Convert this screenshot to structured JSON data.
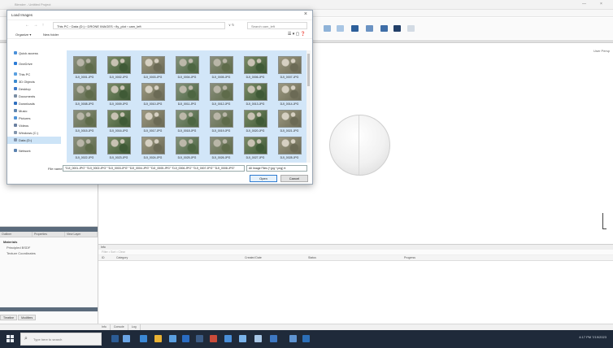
{
  "window": {
    "title": "Blender - Untitled Project",
    "controls": {
      "minimize": "—",
      "close": "×"
    }
  },
  "viewport": {
    "label": "User Persp"
  },
  "left_panel": {
    "tabs": [
      "Outliner",
      "Properties",
      "View Layer"
    ],
    "title": "Materials",
    "items": [
      "Principled BSDF",
      "Texture Coordinates"
    ],
    "bottom_tabs": [
      "Timeline",
      "Modifiers"
    ]
  },
  "results_panel": {
    "tab": "Info",
    "toolbar_text": "Filter • Sort • Clear",
    "columns": [
      "ID",
      "Category",
      "Created Date",
      "Status",
      "Progress"
    ]
  },
  "status_tabs": [
    "Info",
    "Console",
    "Log"
  ],
  "taskbar": {
    "search_placeholder": "Type here to search",
    "clock": "4:17 PM  7/19/2023"
  },
  "dialog": {
    "title": "Load Images",
    "close_symbol": "×",
    "nav_symbols": "← → ↑",
    "path": "This PC  ›  Data (D:)  ›  DRONE IMAGES  ›  fly_plot  ›  cam_left",
    "path_controls": "∨  ↻",
    "search_placeholder": "Search cam_left",
    "organize": "Organize ▾",
    "new_folder": "New folder",
    "view_controls": "☰ ▾   ▢   ❓",
    "nav_items": [
      {
        "label": "Quick access",
        "color": "#4a90d9"
      },
      {
        "label": "OneDrive",
        "color": "#2b7bd6"
      },
      {
        "label": "This PC",
        "color": "#5aa0e0"
      },
      {
        "label": "3D Objects",
        "color": "#3a8ad0"
      },
      {
        "label": "Desktop",
        "color": "#3c78c8"
      },
      {
        "label": "Documents",
        "color": "#7a8ea4"
      },
      {
        "label": "Downloads",
        "color": "#2f6fbf"
      },
      {
        "label": "Music",
        "color": "#5f86b0"
      },
      {
        "label": "Pictures",
        "color": "#4f93d6"
      },
      {
        "label": "Videos",
        "color": "#6a7fa0"
      },
      {
        "label": "Windows (C:)",
        "color": "#8496ad"
      },
      {
        "label": "Data (D:)",
        "color": "#8496ad"
      },
      {
        "label": "Network",
        "color": "#5a82b0"
      }
    ],
    "thumbnails": [
      "DJI_0001.JPG",
      "DJI_0002.JPG",
      "DJI_0003.JPG",
      "DJI_0004.JPG",
      "DJI_0005.JPG",
      "DJI_0006.JPG",
      "DJI_0007.JPG",
      "DJI_0008.JPG",
      "DJI_0009.JPG",
      "DJI_0010.JPG",
      "DJI_0011.JPG",
      "DJI_0012.JPG",
      "DJI_0013.JPG",
      "DJI_0014.JPG",
      "DJI_0015.JPG",
      "DJI_0016.JPG",
      "DJI_0017.JPG",
      "DJI_0018.JPG",
      "DJI_0019.JPG",
      "DJI_0020.JPG",
      "DJI_0021.JPG",
      "DJI_0022.JPG",
      "DJI_0023.JPG",
      "DJI_0024.JPG",
      "DJI_0025.JPG",
      "DJI_0026.JPG",
      "DJI_0027.JPG",
      "DJI_0028.JPG"
    ],
    "filename_label": "File name:",
    "filename_value": "\"DJI_0001.JPG\" \"DJI_0002.JPG\" \"DJI_0003.JPG\" \"DJI_0004.JPG\" \"DJI_0005.JPG\" \"DJI_0006.JPG\" \"DJI_0007.JPG\" \"DJI_0008.JPG\"",
    "filetype_value": "All Image Files (*.jpg *.png) ▾",
    "open_label": "Open",
    "cancel_label": "Cancel"
  }
}
